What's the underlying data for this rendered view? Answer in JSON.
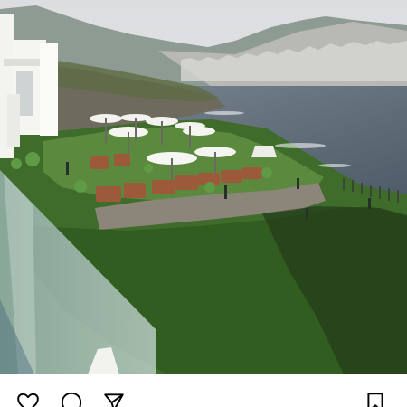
{
  "post": {
    "image_alt": "",
    "scene": {
      "sky": "#e7e7e9",
      "sea": "#5c6b78",
      "cliff": "#6f6a5e",
      "lawn": "#4f7d35",
      "grass": "#395f24",
      "wall": "#8b857a",
      "lounger": "#9c5a3b",
      "umbrella": "#f2f2ee",
      "glass": "#b8ccd0"
    }
  },
  "actions": {
    "like_icon": "heart-icon",
    "comment_icon": "comment-icon",
    "share_icon": "paper-plane-icon",
    "save_icon": "bookmark-icon"
  }
}
